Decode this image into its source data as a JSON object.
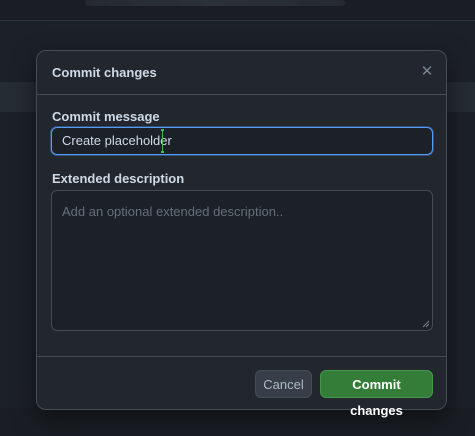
{
  "dialog": {
    "title": "Commit changes",
    "close_icon": "close-icon",
    "commit_message": {
      "label": "Commit message",
      "value": "Create placeholder"
    },
    "extended_description": {
      "label": "Extended description",
      "placeholder": "Add an optional extended description.."
    },
    "footer": {
      "cancel_label": "Cancel",
      "commit_label": "Commit changes"
    }
  },
  "colors": {
    "accent_blue": "#539bf5",
    "commit_green": "#347d39",
    "text_cursor_green": "#3fb950"
  }
}
